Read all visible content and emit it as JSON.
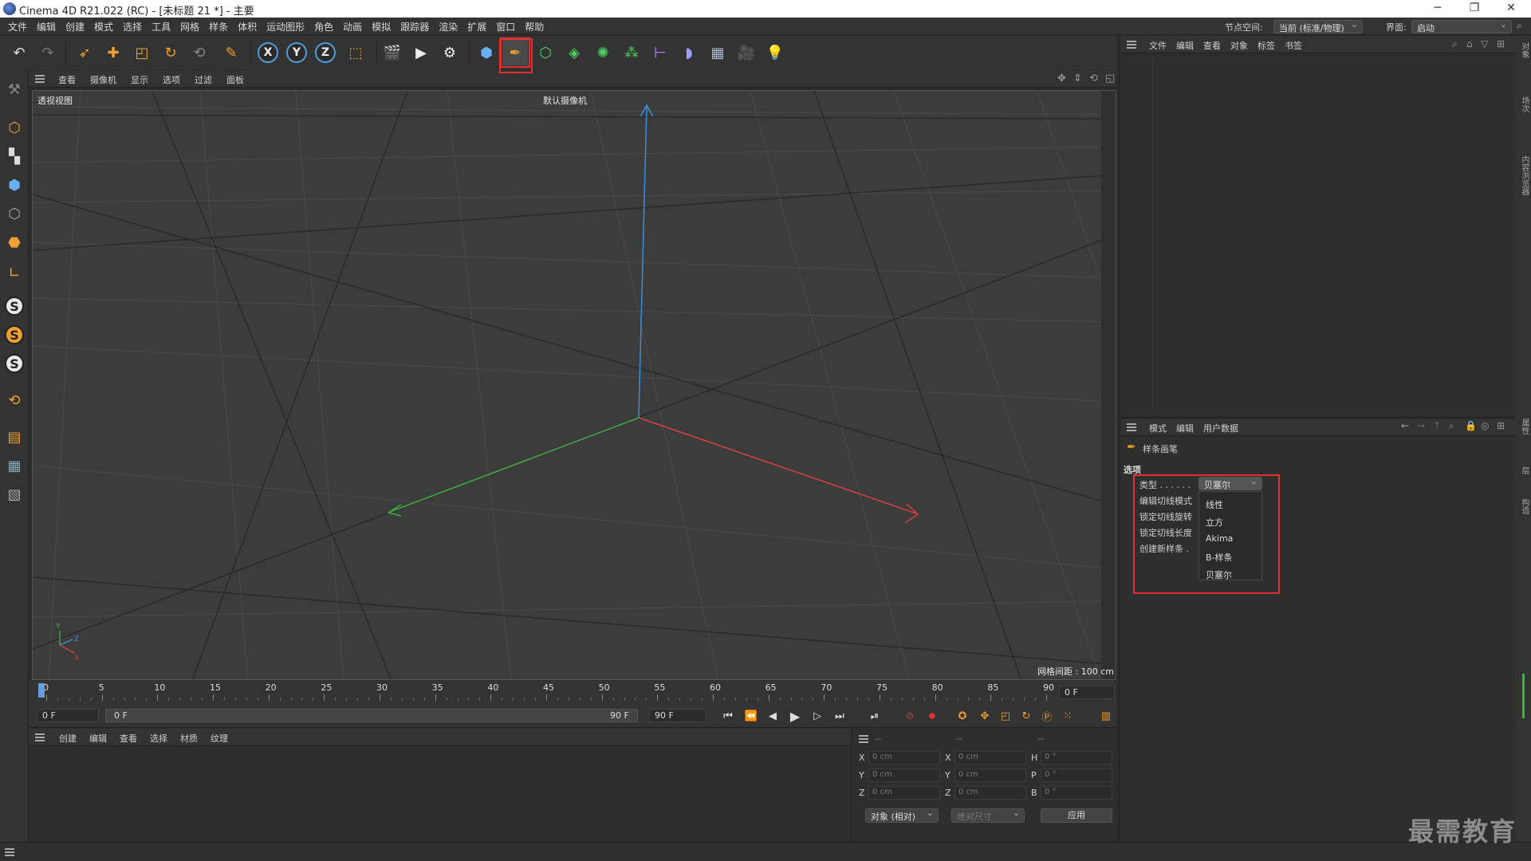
{
  "window": {
    "title": "Cinema 4D R21.022 (RC) - [未标题 21 *] - 主要",
    "minimize": "─",
    "restore": "❐",
    "close": "✕"
  },
  "menubar": {
    "items": [
      "文件",
      "编辑",
      "创建",
      "模式",
      "选择",
      "工具",
      "网格",
      "样条",
      "体积",
      "运动图形",
      "角色",
      "动画",
      "模拟",
      "跟踪器",
      "渲染",
      "扩展",
      "窗口",
      "帮助"
    ],
    "node_space_label": "节点空间:",
    "node_space_value": "当前 (标准/物理)",
    "layout_label": "界面:",
    "layout_value": "启动"
  },
  "toolbar": {
    "icons": [
      "undo-icon",
      "redo-icon",
      "select-icon",
      "move-icon",
      "scale-icon",
      "rotate-icon",
      "recent-tools-icon",
      "live-select-icon",
      "x-axis-icon",
      "y-axis-icon",
      "z-axis-icon",
      "coordinate-system-icon",
      "render-view-icon",
      "render-picture-viewer-icon",
      "render-settings-icon",
      "cube-icon",
      "spline-pen-icon",
      "nurbs-icon",
      "cloner-icon",
      "deformer-icon",
      "array-icon",
      "field-icon",
      "scene-floor-icon",
      "camera-icon",
      "light-icon"
    ],
    "axis_x": "X",
    "axis_y": "Y",
    "axis_z": "Z"
  },
  "viewport": {
    "menu": [
      "查看",
      "摄像机",
      "显示",
      "选项",
      "过滤",
      "面板"
    ],
    "view_name": "透视视图",
    "camera_name": "默认摄像机",
    "grid_spacing": "网格间距 : 100 cm"
  },
  "timeline": {
    "ticks": [
      "0",
      "5",
      "10",
      "15",
      "20",
      "25",
      "30",
      "35",
      "40",
      "45",
      "50",
      "55",
      "60",
      "65",
      "70",
      "75",
      "80",
      "85",
      "90"
    ],
    "current_frame": "0 F",
    "start_frame": "0 F",
    "range_start": "0 F",
    "range_end": "90 F",
    "end_frame": "90 F"
  },
  "material_manager": {
    "menu": [
      "创建",
      "编辑",
      "查看",
      "选择",
      "材质",
      "纹理"
    ]
  },
  "coordinates": {
    "header": [
      "--",
      "--",
      "--"
    ],
    "rows": [
      {
        "a": "X",
        "av": "0 cm",
        "b": "X",
        "bv": "0 cm",
        "c": "H",
        "cv": "0 °"
      },
      {
        "a": "Y",
        "av": "0 cm",
        "b": "Y",
        "bv": "0 cm",
        "c": "P",
        "cv": "0 °"
      },
      {
        "a": "Z",
        "av": "0 cm",
        "b": "Z",
        "bv": "0 cm",
        "c": "B",
        "cv": "0 °"
      }
    ],
    "mode": "对象 (相对)",
    "size_mode": "绝对尺寸",
    "apply": "应用"
  },
  "object_manager": {
    "menu": [
      "文件",
      "编辑",
      "查看",
      "对象",
      "标签",
      "书签"
    ]
  },
  "attribute_manager": {
    "menu": [
      "模式",
      "编辑",
      "用户数据"
    ],
    "tool_name": "样条画笔",
    "section": "选项",
    "type_label": "类型 . . . . . .",
    "type_value": "贝塞尔",
    "options": [
      "编辑切线模式",
      "锁定切线旋转",
      "锁定切线长度",
      "创建新样条 ."
    ],
    "type_list": [
      "线性",
      "立方",
      "Akima",
      "B-样条",
      "贝塞尔"
    ]
  },
  "right_strip": [
    "对象",
    "场次",
    "内容浏览器",
    "属性",
    "层",
    "构造"
  ],
  "watermark": "最需教育",
  "colors": {
    "accent_red": "#e03030",
    "axis_blue": "#4f9bd8",
    "x_axis": "#d84040",
    "y_axis": "#3c8ed8",
    "z_axis": "#40b040"
  }
}
